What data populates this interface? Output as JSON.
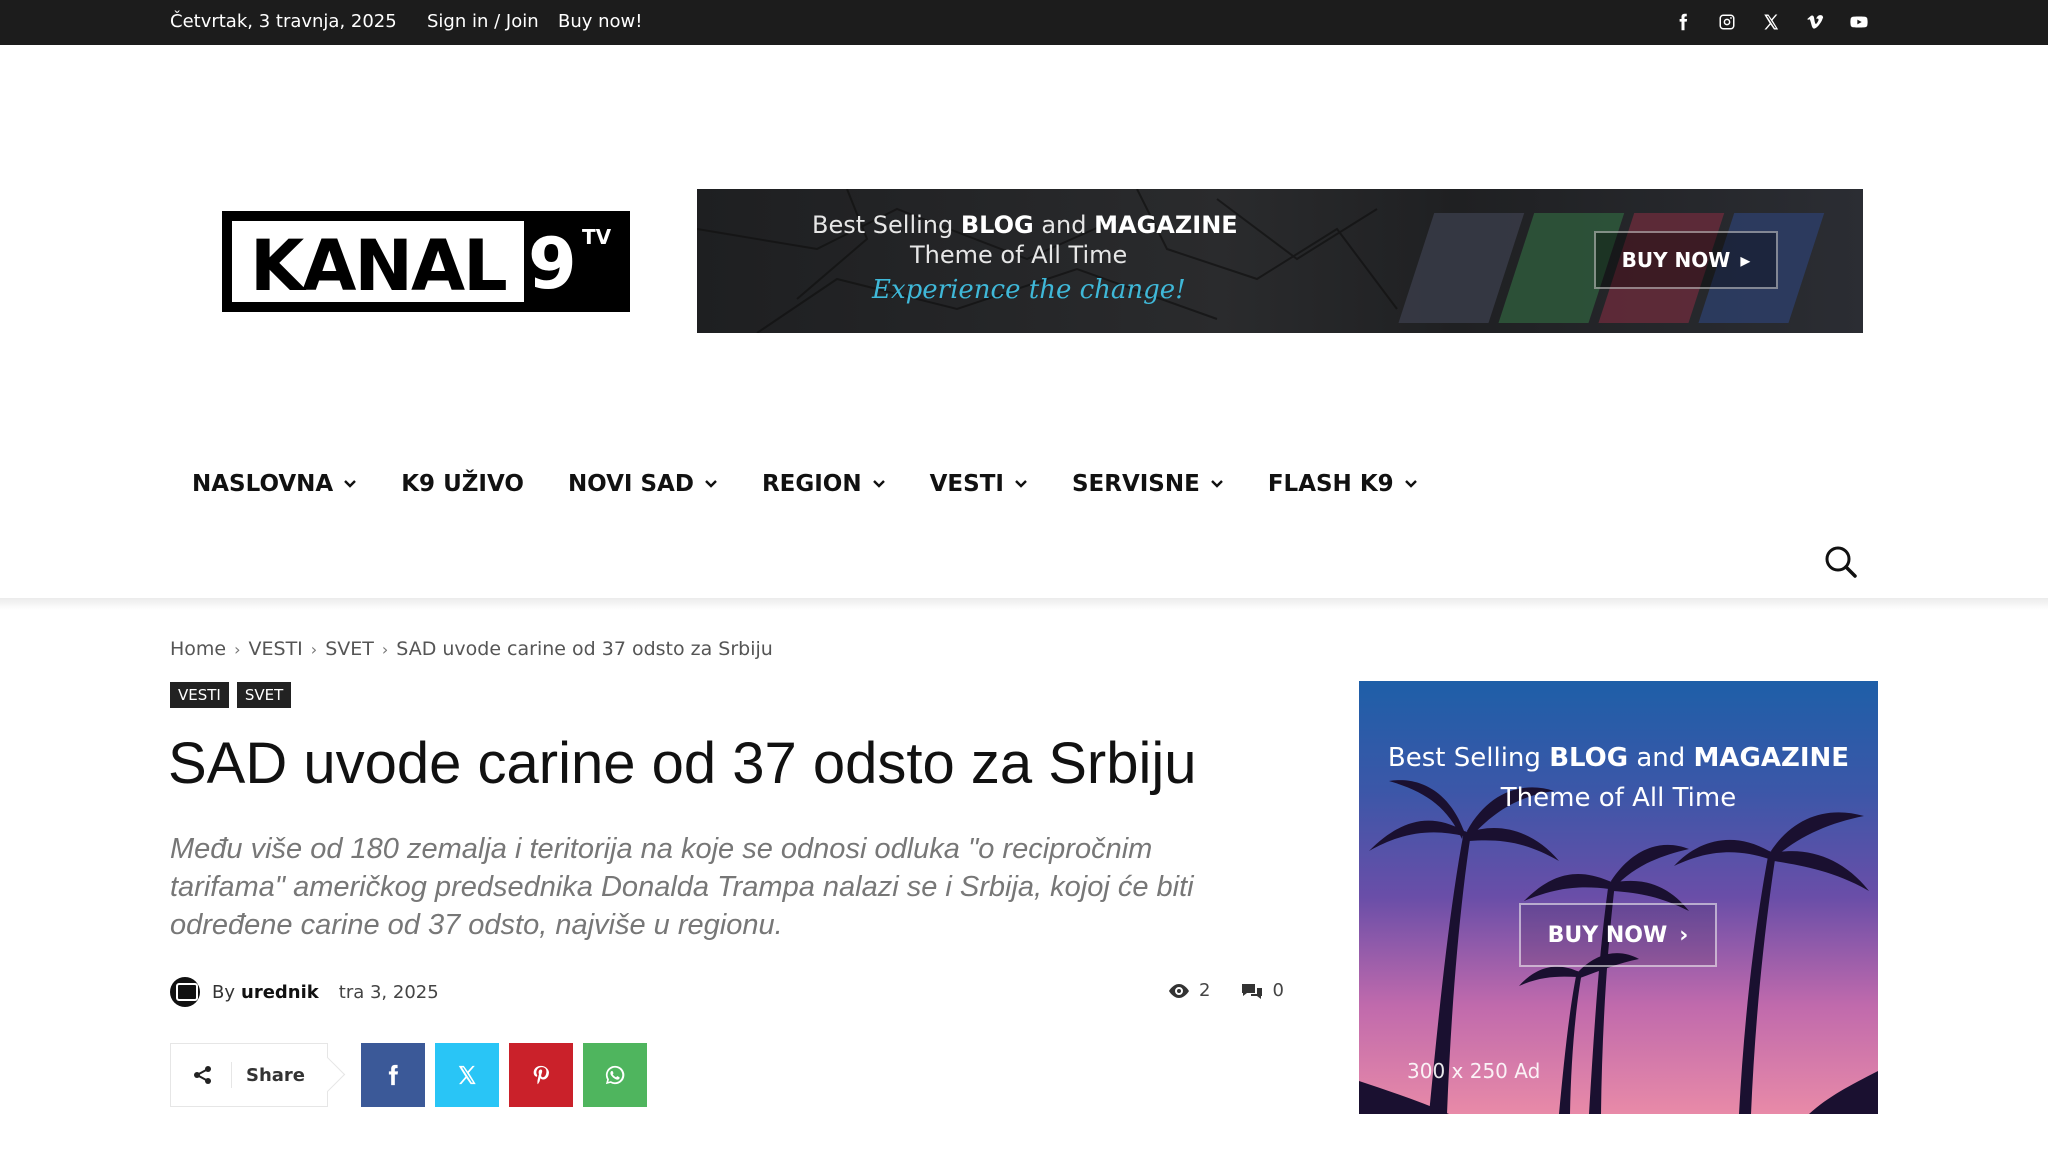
{
  "topbar": {
    "date": "Četvrtak, 3 travnja, 2025",
    "signin": "Sign in / Join",
    "buynow": "Buy now!",
    "social": [
      "facebook-icon",
      "instagram-icon",
      "x-icon",
      "vimeo-icon",
      "youtube-icon"
    ]
  },
  "logo": {
    "text": "KANAL",
    "nine": "9",
    "tv": "TV"
  },
  "header_banner": {
    "line1_a": "Best Selling ",
    "line1_b": "BLOG",
    "line1_c": " and ",
    "line1_d": "MAGAZINE",
    "line2": "Theme of All Time",
    "line3": "Experience the change!",
    "button": "BUY NOW"
  },
  "nav": {
    "items": [
      {
        "label": "NASLOVNA",
        "dropdown": true
      },
      {
        "label": "K9 UŽIVO",
        "dropdown": false
      },
      {
        "label": "NOVI SAD",
        "dropdown": true
      },
      {
        "label": "REGION",
        "dropdown": true
      },
      {
        "label": "VESTI",
        "dropdown": true
      },
      {
        "label": "SERVISNE",
        "dropdown": true
      },
      {
        "label": "FLASH K9",
        "dropdown": true
      }
    ]
  },
  "breadcrumb": [
    "Home",
    "VESTI",
    "SVET",
    "SAD uvode carine od 37 odsto za Srbiju"
  ],
  "tags": [
    "VESTI",
    "SVET"
  ],
  "article": {
    "title": "SAD uvode carine od 37 odsto za Srbiju",
    "subtitle": "Među više od 180 zemalja i teritorija na koje se odnosi odluka \"o recipročnim tarifama\" američkog predsednika Donalda Trampa nalazi se i Srbija, kojoj će biti određene carine od 37 odsto, najviše u regionu.",
    "by": "By",
    "author": "urednik",
    "date": "tra 3, 2025",
    "views": "2",
    "comments": "0"
  },
  "share": {
    "label": "Share"
  },
  "side_ad": {
    "line1_a": "Best Selling ",
    "line1_b": "BLOG",
    "line1_c": " and ",
    "line1_d": "MAGAZINE",
    "line2": "Theme of All Time",
    "button": "BUY NOW",
    "size": "300 x 250 Ad"
  },
  "colors": {
    "topbar_bg": "#1c1c1c",
    "facebook": "#3b5998",
    "twitter": "#29c5f6",
    "pinterest": "#ca212a",
    "whatsapp": "#4fb55e"
  }
}
